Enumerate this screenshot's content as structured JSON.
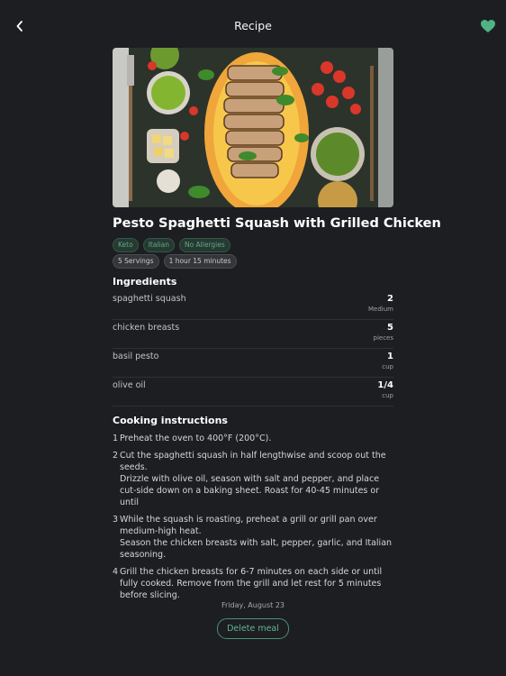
{
  "header": {
    "title": "Recipe"
  },
  "recipe": {
    "title": "Pesto Spaghetti Squash with Grilled Chicken",
    "tags": [
      "Keto",
      "Italian",
      "No Allergies"
    ],
    "meta": [
      "5 Servings",
      "1 hour 15 minutes"
    ]
  },
  "ingredients": {
    "heading": "Ingredients",
    "items": [
      {
        "name": "spaghetti squash",
        "qty": "2",
        "unit": "Medium"
      },
      {
        "name": "chicken breasts",
        "qty": "5",
        "unit": "pieces"
      },
      {
        "name": "basil pesto",
        "qty": "1",
        "unit": "cup"
      },
      {
        "name": "olive oil",
        "qty": "1/4",
        "unit": "cup"
      }
    ]
  },
  "instructions": {
    "heading": "Cooking instructions",
    "steps": [
      {
        "num": "1",
        "text": "Preheat the oven to 400°F (200°C)."
      },
      {
        "num": "2",
        "text": "Cut the spaghetti squash in half lengthwise and scoop out the seeds.\nDrizzle with olive oil, season with salt and pepper, and place cut-side down on a baking sheet. Roast for 40-45 minutes or until"
      },
      {
        "num": "3",
        "text": "While the squash is roasting, preheat a grill or grill pan over medium-high heat.\nSeason the chicken breasts with salt, pepper, garlic, and Italian seasoning."
      },
      {
        "num": "4",
        "text": "Grill the chicken breasts for 6-7 minutes on each side or until fully cooked. Remove from the grill and let rest for 5 minutes before slicing."
      }
    ]
  },
  "footer": {
    "date": "Friday, August 23",
    "delete_label": "Delete meal"
  },
  "icons": {
    "back": "chevron-left-icon",
    "favorite": "heart-icon"
  },
  "colors": {
    "accent": "#4fb384",
    "background": "#1d1e22"
  }
}
